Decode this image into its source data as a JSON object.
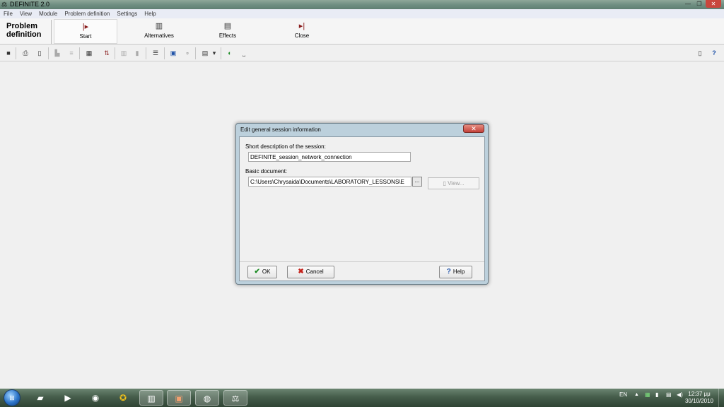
{
  "window": {
    "title": "DEFINITE 2.0",
    "icons": {
      "app": "scales-icon",
      "minimize": "minimize-icon",
      "maximize": "maximize-icon",
      "close": "close-icon"
    }
  },
  "menu": [
    "File",
    "View",
    "Module",
    "Problem definition",
    "Settings",
    "Help"
  ],
  "module": {
    "title": "Problem definition",
    "buttons": [
      {
        "label": "Start",
        "icon": "start-flag-icon"
      },
      {
        "label": "Alternatives",
        "icon": "alternatives-icon"
      },
      {
        "label": "Effects",
        "icon": "effects-icon"
      },
      {
        "label": "Close",
        "icon": "close-module-icon"
      }
    ]
  },
  "toolbar": {
    "icons": [
      "save-icon",
      "print-icon",
      "print-preview-icon",
      "chart-icon",
      "tool-icon",
      "table-icon",
      "sort-icon",
      "columns-icon",
      "bars-icon",
      "rows-icon",
      "copy-icon",
      "page-icon",
      "settings-icon",
      "dropdown-icon",
      "color-icon",
      "spacing-icon",
      "device-icon",
      "help-icon"
    ]
  },
  "dialog": {
    "title": "Edit general session information",
    "short_label": "Short description of the session:",
    "short_value": "DEFINITE_session_network_connection",
    "doc_label": "Basic document:",
    "doc_value": "C:\\Users\\Chrysaida\\Documents\\LABORATORY_LESSONS\\E",
    "browse_label": "...",
    "view_label": "View...",
    "ok_label": "OK",
    "cancel_label": "Cancel",
    "help_label": "Help"
  },
  "taskbar": {
    "apps": [
      "explorer-icon",
      "media-player-icon",
      "chrome-icon",
      "app-icon",
      "books-icon",
      "powerpoint-icon",
      "paint-icon",
      "definite-icon"
    ],
    "language": "EN",
    "time": "12:37 μμ",
    "date": "30/10/2010"
  }
}
